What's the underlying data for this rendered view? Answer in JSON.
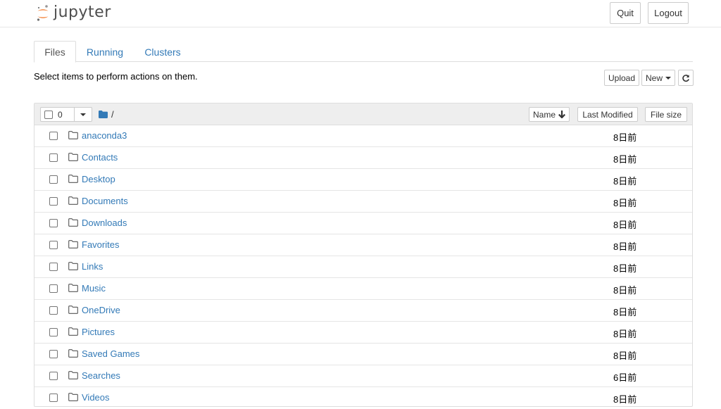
{
  "header": {
    "logo_text": "jupyter",
    "quit_label": "Quit",
    "logout_label": "Logout"
  },
  "tabs": [
    {
      "label": "Files",
      "active": true
    },
    {
      "label": "Running",
      "active": false
    },
    {
      "label": "Clusters",
      "active": false
    }
  ],
  "toolbar": {
    "instructions": "Select items to perform actions on them.",
    "upload_label": "Upload",
    "new_label": "New"
  },
  "list_header": {
    "selected_count": "0",
    "path": "/",
    "name_label": "Name",
    "last_modified_label": "Last Modified",
    "file_size_label": "File size"
  },
  "files": [
    {
      "name": "anaconda3",
      "modified": "8日前"
    },
    {
      "name": "Contacts",
      "modified": "8日前"
    },
    {
      "name": "Desktop",
      "modified": "8日前"
    },
    {
      "name": "Documents",
      "modified": "8日前"
    },
    {
      "name": "Downloads",
      "modified": "8日前"
    },
    {
      "name": "Favorites",
      "modified": "8日前"
    },
    {
      "name": "Links",
      "modified": "8日前"
    },
    {
      "name": "Music",
      "modified": "8日前"
    },
    {
      "name": "OneDrive",
      "modified": "8日前"
    },
    {
      "name": "Pictures",
      "modified": "8日前"
    },
    {
      "name": "Saved Games",
      "modified": "8日前"
    },
    {
      "name": "Searches",
      "modified": "6日前"
    },
    {
      "name": "Videos",
      "modified": "8日前"
    }
  ],
  "colors": {
    "link": "#337ab7",
    "jupyter_orange": "#f37726",
    "header_bg": "#eeeeee"
  }
}
